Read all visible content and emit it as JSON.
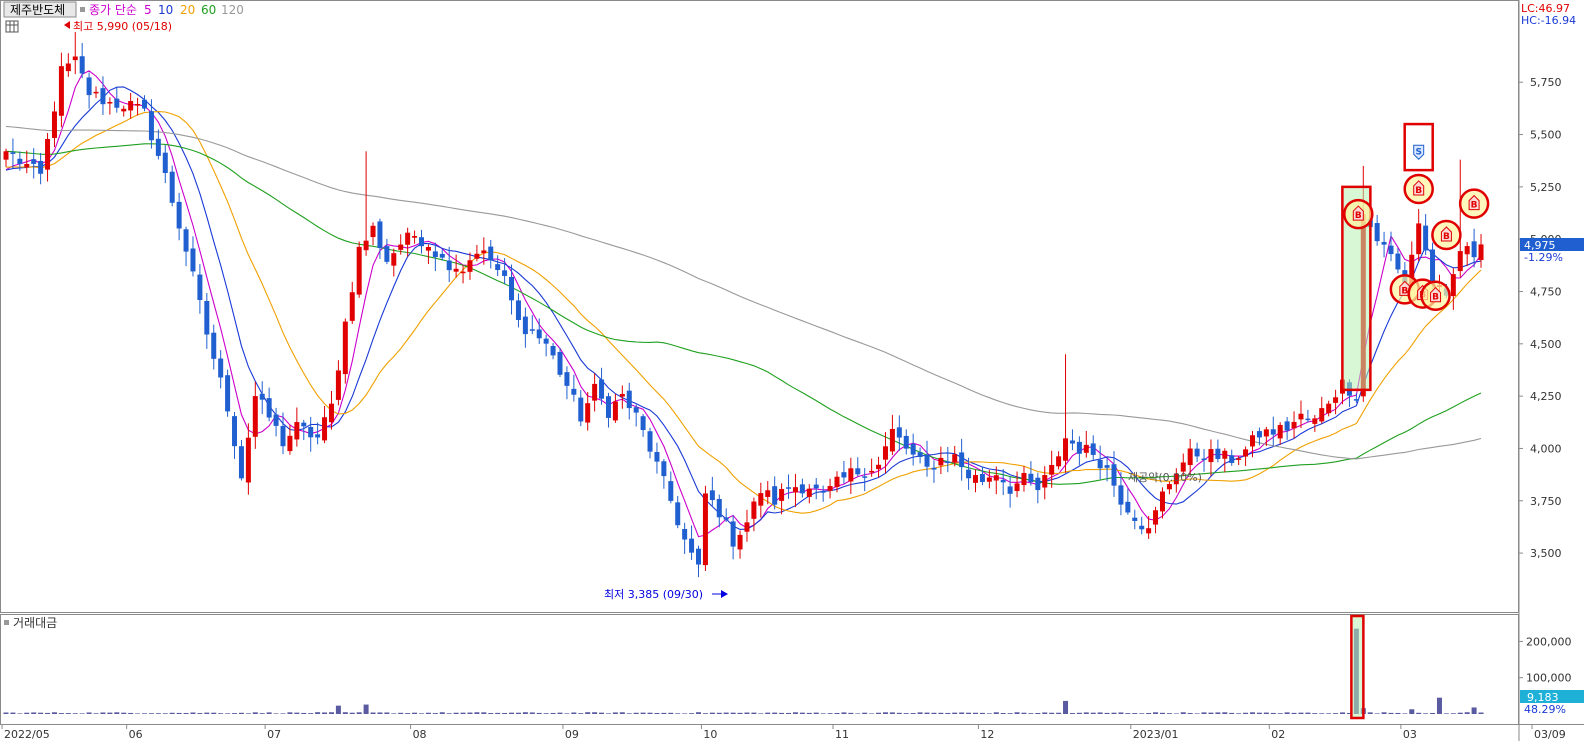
{
  "header": {
    "stock_name": "제주반도체",
    "ma_label": "종가 단순",
    "ma_periods": [
      "5",
      "10",
      "20",
      "60",
      "120"
    ],
    "ma_colors": [
      "#cc00cc",
      "#1a3ad6",
      "#f0a000",
      "#20a020",
      "#999999"
    ],
    "lc_text": "LC:46.97",
    "hc_text": "HC:-16.94"
  },
  "annotations": {
    "high_label": "최고 5,990 (05/18)",
    "low_label": "최저 3,385 (09/30)",
    "watermark": "제공약(0.00%)",
    "buy_marker": "B",
    "sell_marker": "S"
  },
  "price_box": {
    "value": "4,975",
    "change": "-1.29%"
  },
  "volume_panel": {
    "title": "거래대금",
    "value": "9,183",
    "change": "48.29%"
  },
  "chart_data": {
    "type": "candlestick",
    "price_axis": {
      "ylim": [
        3295,
        5990
      ],
      "ticks": [
        "3,500",
        "3,750",
        "4,000",
        "4,250",
        "4,500",
        "4,750",
        "5,000",
        "5,250",
        "5,500",
        "5,750"
      ]
    },
    "volume_axis": {
      "ylim": [
        0,
        270000
      ],
      "ticks": [
        "100,000",
        "200,000"
      ]
    },
    "x_tick_labels": [
      {
        "i": 0,
        "label": "2022/05"
      },
      {
        "i": 18,
        "label": "06"
      },
      {
        "i": 38,
        "label": "07"
      },
      {
        "i": 59,
        "label": "08"
      },
      {
        "i": 81,
        "label": "09"
      },
      {
        "i": 101,
        "label": "10"
      },
      {
        "i": 120,
        "label": "11"
      },
      {
        "i": 141,
        "label": "12"
      },
      {
        "i": 163,
        "label": "2023/01"
      },
      {
        "i": 183,
        "label": "02"
      },
      {
        "i": 202,
        "label": "03"
      },
      {
        "i": 213,
        "label": "03/09"
      }
    ],
    "close_anchors": [
      [
        0,
        5420
      ],
      [
        3,
        5350
      ],
      [
        5,
        5300
      ],
      [
        8,
        5800
      ],
      [
        10,
        5850
      ],
      [
        12,
        5700
      ],
      [
        15,
        5650
      ],
      [
        18,
        5640
      ],
      [
        20,
        5600
      ],
      [
        23,
        5300
      ],
      [
        26,
        4950
      ],
      [
        29,
        4550
      ],
      [
        32,
        4200
      ],
      [
        34,
        3870
      ],
      [
        36,
        4250
      ],
      [
        38,
        4150
      ],
      [
        40,
        4030
      ],
      [
        42,
        4100
      ],
      [
        45,
        4050
      ],
      [
        47,
        4200
      ],
      [
        49,
        4600
      ],
      [
        51,
        4950
      ],
      [
        53,
        5050
      ],
      [
        55,
        4900
      ],
      [
        57,
        4980
      ],
      [
        59,
        5020
      ],
      [
        61,
        4980
      ],
      [
        63,
        4900
      ],
      [
        66,
        4860
      ],
      [
        68,
        4950
      ],
      [
        70,
        4900
      ],
      [
        72,
        4800
      ],
      [
        74,
        4600
      ],
      [
        76,
        4560
      ],
      [
        78,
        4500
      ],
      [
        81,
        4300
      ],
      [
        83,
        4150
      ],
      [
        85,
        4280
      ],
      [
        87,
        4180
      ],
      [
        89,
        4250
      ],
      [
        91,
        4150
      ],
      [
        93,
        4000
      ],
      [
        96,
        3750
      ],
      [
        98,
        3560
      ],
      [
        100,
        3420
      ],
      [
        101,
        3780
      ],
      [
        103,
        3700
      ],
      [
        105,
        3560
      ],
      [
        107,
        3650
      ],
      [
        109,
        3800
      ],
      [
        111,
        3750
      ],
      [
        113,
        3820
      ],
      [
        116,
        3820
      ],
      [
        118,
        3770
      ],
      [
        120,
        3830
      ],
      [
        122,
        3880
      ],
      [
        124,
        3900
      ],
      [
        126,
        3920
      ],
      [
        128,
        4080
      ],
      [
        131,
        3960
      ],
      [
        133,
        3900
      ],
      [
        135,
        3950
      ],
      [
        137,
        3960
      ],
      [
        139,
        3870
      ],
      [
        141,
        3850
      ],
      [
        143,
        3890
      ],
      [
        145,
        3810
      ],
      [
        147,
        3850
      ],
      [
        149,
        3800
      ],
      [
        151,
        3900
      ],
      [
        153,
        4050
      ],
      [
        155,
        4000
      ],
      [
        157,
        3980
      ],
      [
        159,
        3900
      ],
      [
        161,
        3760
      ],
      [
        163,
        3680
      ],
      [
        165,
        3600
      ],
      [
        167,
        3780
      ],
      [
        169,
        3900
      ],
      [
        171,
        3970
      ],
      [
        173,
        3980
      ],
      [
        175,
        3960
      ],
      [
        177,
        3950
      ],
      [
        179,
        3990
      ],
      [
        181,
        4070
      ],
      [
        183,
        4080
      ],
      [
        185,
        4100
      ],
      [
        187,
        4150
      ],
      [
        189,
        4130
      ],
      [
        191,
        4230
      ],
      [
        193,
        4310
      ],
      [
        195,
        4260
      ],
      [
        196,
        5120
      ],
      [
        198,
        5000
      ],
      [
        200,
        4920
      ],
      [
        202,
        4780
      ],
      [
        204,
        5080
      ],
      [
        206,
        4800
      ],
      [
        208,
        4700
      ],
      [
        210,
        4950
      ],
      [
        212,
        4930
      ],
      [
        213,
        4975
      ]
    ],
    "volume_spikes": [
      [
        48,
        23000
      ],
      [
        52,
        26000
      ],
      [
        153,
        36000
      ],
      [
        195,
        235000
      ],
      [
        196,
        16000
      ],
      [
        203,
        13000
      ],
      [
        207,
        45000
      ],
      [
        212,
        18000
      ]
    ],
    "signals": [
      {
        "i": 196,
        "type": "B"
      },
      {
        "i": 204,
        "type": "S"
      },
      {
        "i": 204,
        "type": "B"
      },
      {
        "i": 202,
        "type": "B"
      },
      {
        "i": 205,
        "type": "B"
      },
      {
        "i": 206,
        "type": "B"
      },
      {
        "i": 208,
        "type": "B"
      },
      {
        "i": 212,
        "type": "B"
      }
    ]
  }
}
